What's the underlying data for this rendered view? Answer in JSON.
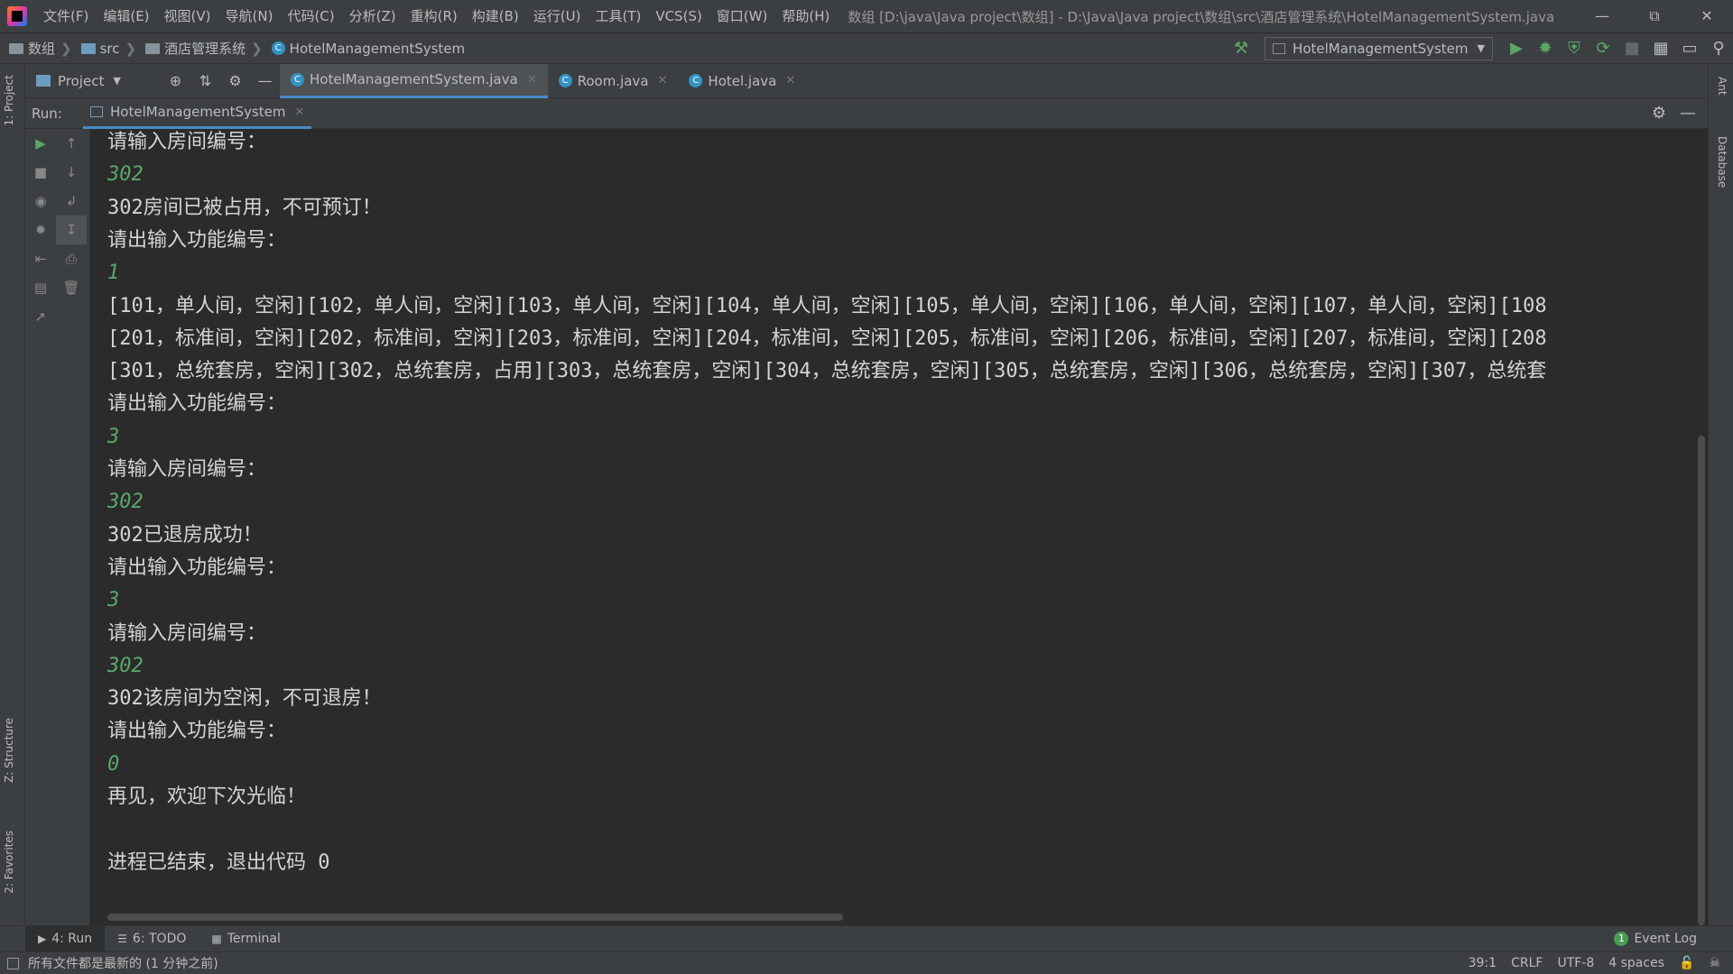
{
  "menubar": {
    "items": [
      "文件(F)",
      "编辑(E)",
      "视图(V)",
      "导航(N)",
      "代码(C)",
      "分析(Z)",
      "重构(R)",
      "构建(B)",
      "运行(U)",
      "工具(T)",
      "VCS(S)",
      "窗口(W)",
      "帮助(H)"
    ],
    "window_title": "数组 [D:\\java\\Java project\\数组] - D:\\Java\\Java project\\数组\\src\\酒店管理系统\\HotelManagementSystem.java"
  },
  "navbar": {
    "crumbs": [
      "数组",
      "src",
      "酒店管理系统",
      "HotelManagementSystem"
    ],
    "run_config": "HotelManagementSystem"
  },
  "tabrow": {
    "project_label": "Project",
    "tabs": [
      "HotelManagementSystem.java",
      "Room.java",
      "Hotel.java"
    ]
  },
  "left_stripe": {
    "project": "1: Project",
    "structure": "Z: Structure",
    "favorites": "2: Favorites"
  },
  "right_stripe": {
    "ant": "Ant",
    "database": "Database"
  },
  "run_panel": {
    "label": "Run:",
    "tab": "HotelManagementSystem"
  },
  "console": {
    "lines": [
      {
        "text": "请输入房间编号：",
        "type": "output"
      },
      {
        "text": "302",
        "type": "input"
      },
      {
        "text": "302房间已被占用，不可预订！",
        "type": "output"
      },
      {
        "text": "请出输入功能编号：",
        "type": "output"
      },
      {
        "text": "1",
        "type": "input"
      },
      {
        "text": "[101，单人间，空闲][102，单人间，空闲][103，单人间，空闲][104，单人间，空闲][105，单人间，空闲][106，单人间，空闲][107，单人间，空闲][108",
        "type": "output"
      },
      {
        "text": "[201，标准间，空闲][202，标准间，空闲][203，标准间，空闲][204，标准间，空闲][205，标准间，空闲][206，标准间，空闲][207，标准间，空闲][208",
        "type": "output"
      },
      {
        "text": "[301，总统套房，空闲][302，总统套房，占用][303，总统套房，空闲][304，总统套房，空闲][305，总统套房，空闲][306，总统套房，空闲][307，总统套",
        "type": "output"
      },
      {
        "text": "请出输入功能编号：",
        "type": "output"
      },
      {
        "text": "3",
        "type": "input"
      },
      {
        "text": "请输入房间编号：",
        "type": "output"
      },
      {
        "text": "302",
        "type": "input"
      },
      {
        "text": "302已退房成功！",
        "type": "output"
      },
      {
        "text": "请出输入功能编号：",
        "type": "output"
      },
      {
        "text": "3",
        "type": "input"
      },
      {
        "text": "请输入房间编号：",
        "type": "output"
      },
      {
        "text": "302",
        "type": "input"
      },
      {
        "text": "302该房间为空闲，不可退房！",
        "type": "output"
      },
      {
        "text": "请出输入功能编号：",
        "type": "output"
      },
      {
        "text": "0",
        "type": "input"
      },
      {
        "text": "再见，欢迎下次光临！",
        "type": "output"
      },
      {
        "text": "",
        "type": "output"
      },
      {
        "text": "进程已结束，退出代码 0",
        "type": "output"
      }
    ]
  },
  "bottom_tabs": {
    "run": "4: Run",
    "todo": "6: TODO",
    "terminal": "Terminal",
    "event_log": "Event Log",
    "event_count": "1"
  },
  "statusbar": {
    "message": "所有文件都是最新的 (1 分钟之前)",
    "position": "39:1",
    "line_sep": "CRLF",
    "encoding": "UTF-8",
    "indent": "4 spaces"
  },
  "colors": {
    "background": "#2b2b2b",
    "panel": "#3c3f41",
    "console_text": "#d4d4d4",
    "console_input": "#59a869",
    "accent": "#4a88c7"
  }
}
